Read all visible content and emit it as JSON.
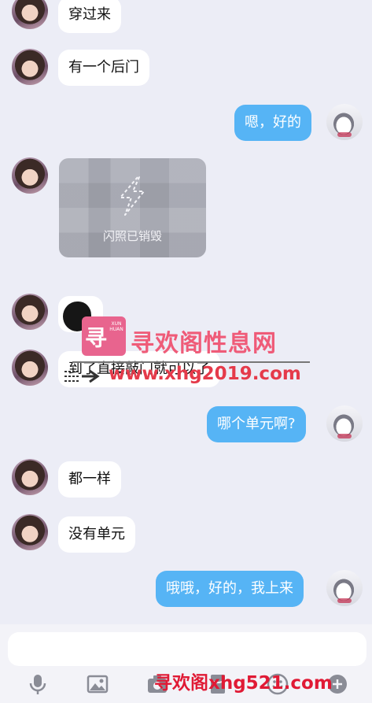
{
  "messages": [
    {
      "side": "left",
      "text": "穿过来"
    },
    {
      "side": "left",
      "text": "有一个后门"
    },
    {
      "side": "right",
      "text": "嗯，好的"
    },
    {
      "side": "left",
      "type": "flash_image",
      "text": "闪照已销毁"
    },
    {
      "side": "left",
      "type": "redacted",
      "text": ""
    },
    {
      "side": "left",
      "text": "到了直接敲门就可以了"
    },
    {
      "side": "right",
      "text": "哪个单元啊?"
    },
    {
      "side": "left",
      "text": "都一样"
    },
    {
      "side": "left",
      "text": "没有单元"
    },
    {
      "side": "right",
      "text": "哦哦，好的，我上来"
    }
  ],
  "watermark": {
    "logo_char": "寻",
    "logo_sub": "XUN HUAN",
    "title": "寻欢阁性息网",
    "url": "www.xhg2019.com",
    "bottom": "寻欢阁xhg521.com"
  },
  "composer": {
    "placeholder": "",
    "icons": [
      "microphone-icon",
      "image-icon",
      "camera-icon",
      "red-packet-icon",
      "emoji-icon",
      "plus-icon"
    ]
  }
}
